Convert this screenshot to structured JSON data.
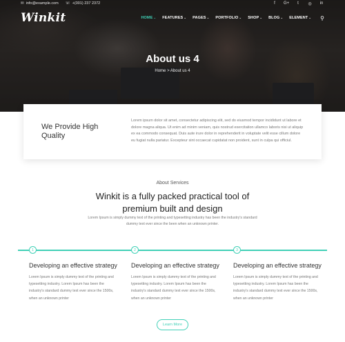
{
  "topbar": {
    "email": "info@example.com",
    "phone": "+(001) 237 2372",
    "socials": [
      "f",
      "G+",
      "t",
      "in",
      "in"
    ]
  },
  "nav": {
    "logo": "Winkit",
    "items": [
      {
        "label": "HOME",
        "active": true
      },
      {
        "label": "FEATURES",
        "active": false
      },
      {
        "label": "PAGES",
        "active": false
      },
      {
        "label": "PORTFOLIO",
        "active": false
      },
      {
        "label": "SHOP",
        "active": false
      },
      {
        "label": "BLOG",
        "active": false
      },
      {
        "label": "ELEMENT",
        "active": false
      }
    ],
    "chevron": "⌄",
    "accent": "#3fd0b6"
  },
  "hero": {
    "title": "About us 4",
    "breadcrumb": "Home > About us 4"
  },
  "feature": {
    "heading": "We Provide High Quality",
    "body": "Lorem ipsum dolor sit amet, consectetur adipiscing elit, sed do eiusmod tempor incididunt ut labore et dolore magna aliqua. Ut enim ad minim veniam, quis nostrud exercitation ullamco laboris nisi ut aliquip ex ea commodo consequat. Duis aute irure dolor in reprehenderit in voluptate velit esse cillum dolore eu fugiat nulla pariatur. Excepteur sint occaecat cupidatat non proident, sunt in culpa qui officiul."
  },
  "services": {
    "kicker": "About Services",
    "title": "Winkit is a fully packed practical tool of premium built and design",
    "desc": "Lorem Ipsum is simply dummy text of the printing and typesetting industry has been the industry's standard dummy text ever since the been when an unknown printer.",
    "steps": [
      {
        "num": "1",
        "title": "Developing an effective strategy",
        "desc": "Lorem Ipsum is simply dummy text of the printing and typesetting industry. Lorem Ipsum has been the industry's standard dummy text ever since the 1500s, when an unknown printer"
      },
      {
        "num": "2",
        "title": "Developing an effective strategy",
        "desc": "Lorem Ipsum is simply dummy text of the printing and typesetting industry. Lorem Ipsum has been the industry's standard dummy text ever since the 1500s, when an unknown printer"
      },
      {
        "num": "3",
        "title": "Developing an effective strategy",
        "desc": "Lorem Ipsum is simply dummy text of the printing and typesetting industry. Lorem Ipsum has been the industry's standard dummy text ever since the 1500s, when an unknown printer"
      }
    ],
    "learn_more": "Learn More"
  }
}
